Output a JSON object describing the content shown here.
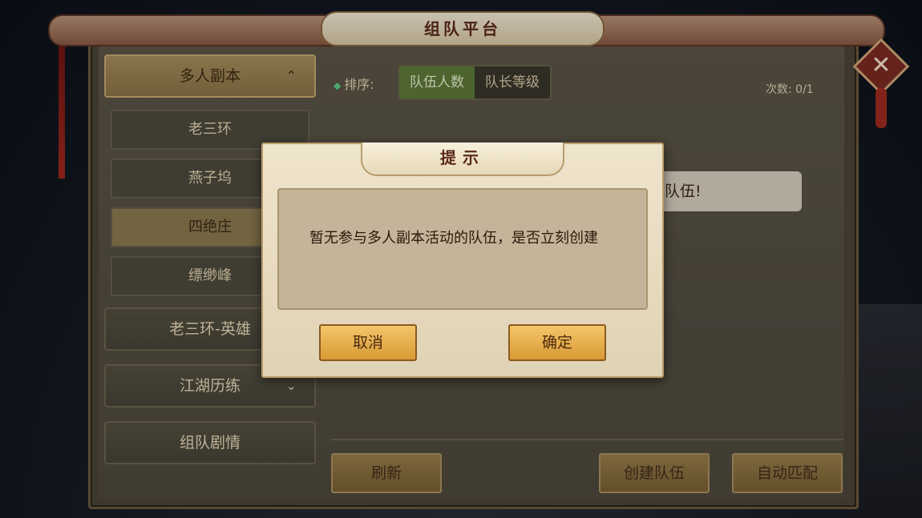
{
  "header": {
    "title": "组队平台"
  },
  "sidebar": {
    "categories": [
      {
        "label": "多人副本",
        "chevron": "⌃"
      },
      {
        "label": "老三环-英雄"
      },
      {
        "label": "江湖历练",
        "chevron": "⌄"
      },
      {
        "label": "组队剧情"
      }
    ],
    "subitems": [
      "老三环",
      "燕子坞",
      "四绝庄",
      "缥缈峰"
    ]
  },
  "sort": {
    "label": "排序:",
    "options": [
      "队伍人数",
      "队长等级"
    ],
    "selected": "队伍人数"
  },
  "count": "次数: 0/1",
  "empty_message": "有队伍!",
  "empty_message_visible": "前队伍!",
  "buttons": {
    "refresh": "刷新",
    "create": "创建队伍",
    "auto_match": "自动匹配"
  },
  "dialog": {
    "title": "提示",
    "message": "暂无参与多人副本活动的队伍，是否立刻创建",
    "cancel": "取消",
    "confirm": "确定"
  }
}
